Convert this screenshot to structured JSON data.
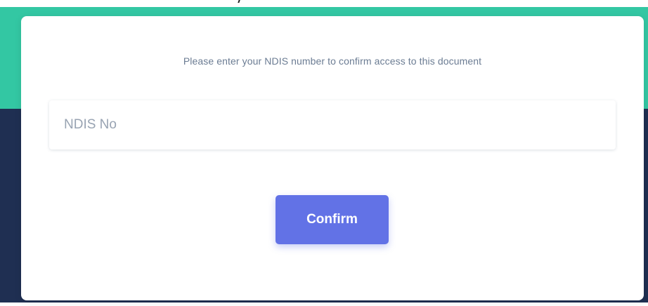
{
  "colors": {
    "accent_teal": "#33c7a3",
    "navy": "#1f2f52",
    "button": "#6272e6",
    "message_text": "#6b7c93"
  },
  "dialog": {
    "message": "Please enter your NDIS number to confirm access to this document",
    "ndis_input": {
      "placeholder": "NDIS No",
      "value": ""
    },
    "confirm_label": "Confirm"
  }
}
